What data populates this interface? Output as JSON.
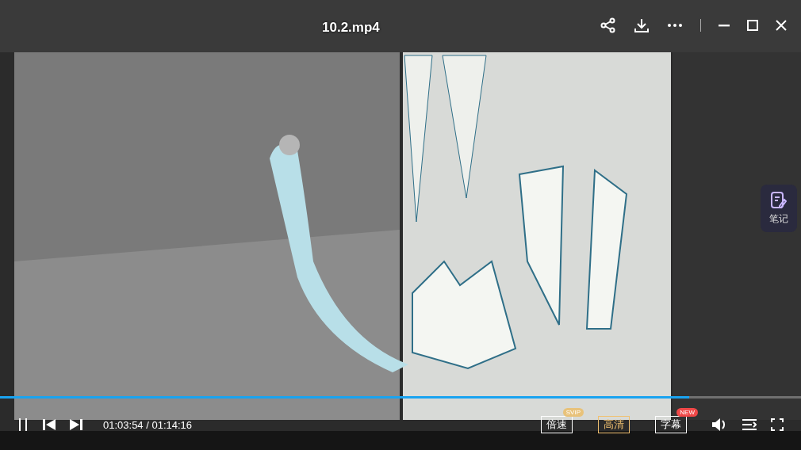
{
  "title": "10.2.mp4",
  "notes_button": {
    "label": "笔记"
  },
  "progress": {
    "level": 0.86
  },
  "time": {
    "current": "01:03:54",
    "total": "01:14:16",
    "separator": "/"
  },
  "buttons": [
    {
      "label": "倍速",
      "badge": "SVIP",
      "color": "#e8c27a",
      "selected": false
    },
    {
      "label": "高清",
      "selected": true
    },
    {
      "label": "字幕",
      "badge": "NEW",
      "color": "#f04848",
      "selected": false
    }
  ]
}
